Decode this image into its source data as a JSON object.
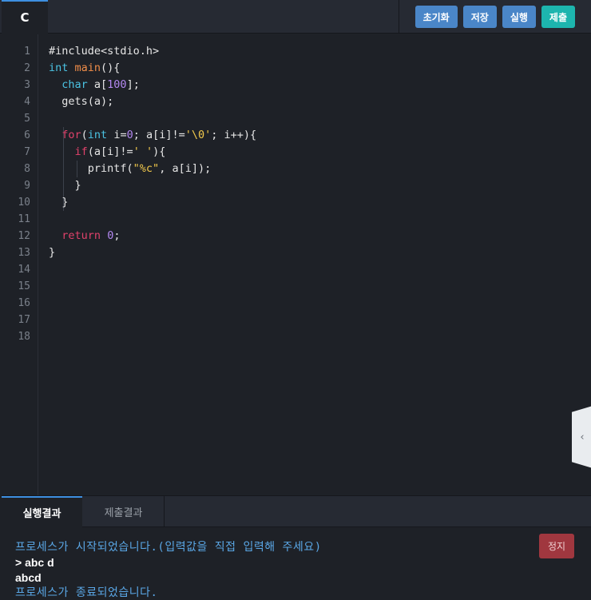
{
  "header": {
    "language_tab": "C",
    "buttons": {
      "reset": "초기화",
      "save": "저장",
      "run": "실행",
      "submit": "제출"
    }
  },
  "editor": {
    "line_numbers": [
      "1",
      "2",
      "3",
      "4",
      "5",
      "6",
      "7",
      "8",
      "9",
      "10",
      "11",
      "12",
      "13",
      "14",
      "15",
      "16",
      "17",
      "18"
    ],
    "code_lines": [
      "#include<stdio.h>",
      "int main(){",
      "  char a[100];",
      "  gets(a);",
      "",
      "  for(int i=0; a[i]!='\\0'; i++){",
      "    if(a[i]!=' '){",
      "      printf(\"%c\", a[i]);",
      "    }",
      "  }",
      "",
      "  return 0;",
      "}"
    ],
    "side_handle_icon": "chevron-left-icon"
  },
  "output_tabs": {
    "run_result": "실행결과",
    "submit_result": "제출결과"
  },
  "console": {
    "start_message": "프로세스가 시작되었습니다.(입력값을 직접 입력해 주세요)",
    "input_line": "> abc d",
    "output_line": "abcd",
    "end_message": "프로세스가 종료되었습니다.",
    "stop_button": "정지"
  },
  "colors": {
    "background": "#1e2127",
    "accent_blue": "#4a86c8",
    "accent_teal": "#1db5ae",
    "stop_red": "#a0373f",
    "console_text": "#5aa7e6"
  }
}
